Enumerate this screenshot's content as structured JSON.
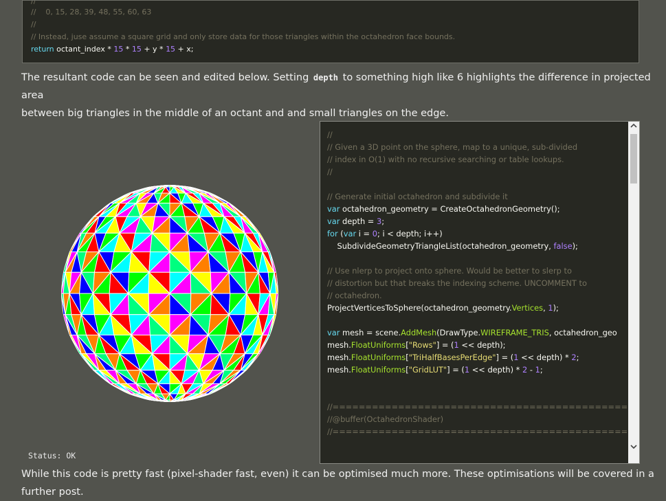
{
  "top_code": {
    "line1": "//    0, 15, 28, 39, 48, 55, 60, 63",
    "line2": "//",
    "line3": "// Instead, juse assume a square grid and only store data for those triangles within the octahedron face bounds.",
    "line4_kw": "return",
    "line4_a": " octant_index * ",
    "line4_n1": "15",
    "line4_b": " * ",
    "line4_n2": "15",
    "line4_c": " + y * ",
    "line4_n3": "15",
    "line4_d": " + x;"
  },
  "paragraph1": {
    "part1": "The resultant code can be seen and edited below. Setting ",
    "code": "depth",
    "part2": " to something high like 6 highlights the difference in projected area",
    "line2": "between big triangles in the middle of an octant and and small triangles on the edge."
  },
  "editor": {
    "l1": "//",
    "l2": "// Given a 3D point on the sphere, map to a unique, sub-divided",
    "l3": "// index in O(1) with no recursive searching or table lookups.",
    "l4": "//",
    "l6": "// Generate initial octahedron and subdivide it",
    "l7_kw": "var",
    "l7_rest": " octahedron_geometry = CreateOctahedronGeometry();",
    "l8_kw": "var",
    "l8_rest": " depth = ",
    "l8_num": "3",
    "l8_end": ";",
    "l9_kw": "for",
    "l9_a": " (",
    "l9_kw2": "var",
    "l9_b": " i = ",
    "l9_num": "0",
    "l9_c": "; i < depth; i++)",
    "l10_a": "    SubdivideGeometryTriangleList(octahedron_geometry, ",
    "l10_kw": "false",
    "l10_b": ");",
    "l12": "// Use nlerp to project onto sphere. Would be better to slerp to",
    "l13": "// distortion but that breaks the indexing scheme. UNCOMMENT to",
    "l14": "// octahedron.",
    "l15_a": "ProjectVerticesToSphere(octahedron_geometry.",
    "l15_fn": "Vertices",
    "l15_b": ", ",
    "l15_num": "1",
    "l15_c": ");",
    "l17_kw": "var",
    "l17_a": " mesh = scene.",
    "l17_fn": "AddMesh",
    "l17_b": "(DrawType.",
    "l17_fn2": "WIREFRAME_TRIS",
    "l17_c": ", octahedron_geo",
    "l18_a": "mesh.",
    "l18_fn": "FloatUniforms",
    "l18_b": "[",
    "l18_str": "\"Rows\"",
    "l18_c": "] = (",
    "l18_num": "1",
    "l18_d": " << depth);",
    "l19_a": "mesh.",
    "l19_fn": "FloatUniforms",
    "l19_b": "[",
    "l19_str": "\"TriHalfBasesPerEdge\"",
    "l19_c": "] = (",
    "l19_num": "1",
    "l19_d": " << depth) * ",
    "l19_num2": "2",
    "l19_e": ";",
    "l20_a": "mesh.",
    "l20_fn": "FloatUniforms",
    "l20_b": "[",
    "l20_str": "\"GridLUT\"",
    "l20_c": "] = (",
    "l20_num": "1",
    "l20_d": " << depth) * ",
    "l20_num2": "2",
    "l20_e": " - ",
    "l20_num3": "1",
    "l20_f": ";",
    "l24": "//==============================================================",
    "l25": "//@buffer(OctahedronShader)",
    "l26": "//=============================================================="
  },
  "status": "Status: OK",
  "paragraph2": "While this code is pretty fast (pixel-shader fast, even) it can be optimised much more. These optimisations will be covered in a further post.",
  "colors": {
    "page_bg": "#52534d",
    "code_bg": "#272822",
    "comment": "#75715e",
    "keyword": "#66d9ef",
    "function": "#a6e22e",
    "number": "#ae81ff",
    "string": "#e6db74"
  },
  "icons": {
    "scroll_up": "chevron-up-icon",
    "scroll_down": "chevron-down-icon"
  }
}
